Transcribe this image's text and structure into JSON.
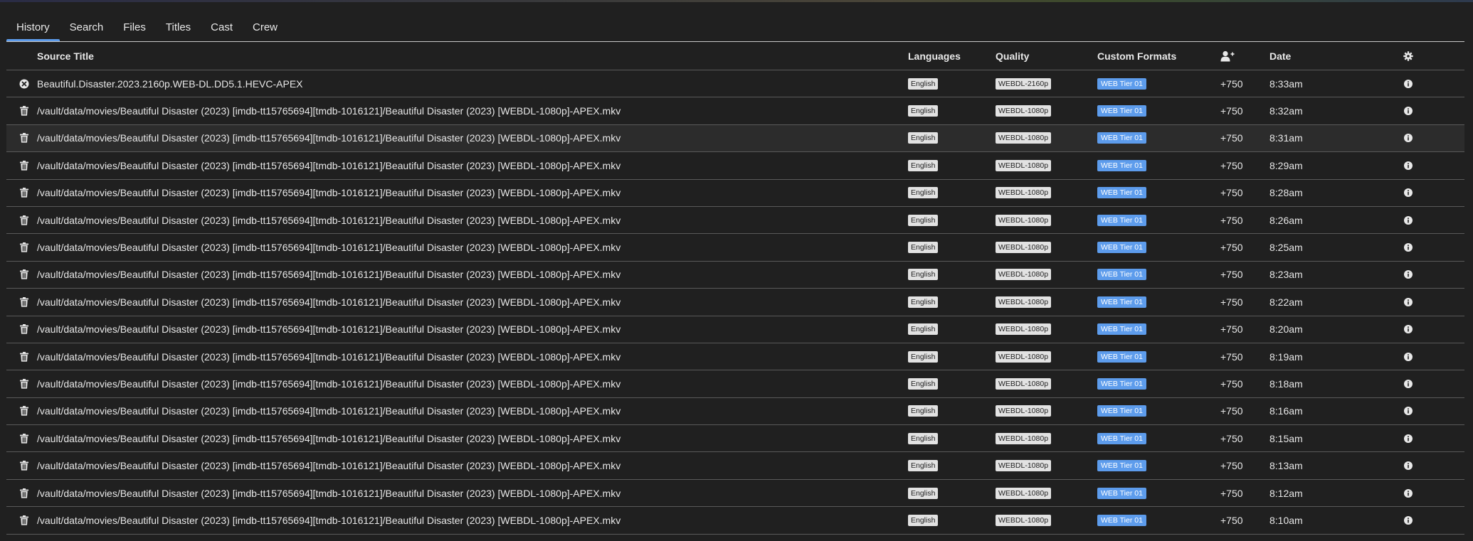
{
  "tabs": [
    {
      "label": "History",
      "active": true
    },
    {
      "label": "Search",
      "active": false
    },
    {
      "label": "Files",
      "active": false
    },
    {
      "label": "Titles",
      "active": false
    },
    {
      "label": "Cast",
      "active": false
    },
    {
      "label": "Crew",
      "active": false
    }
  ],
  "table": {
    "headers": {
      "source_title": "Source Title",
      "languages": "Languages",
      "quality": "Quality",
      "custom_formats": "Custom Formats",
      "score_icon": "user-plus-icon",
      "date": "Date",
      "settings_icon": "gear-icon"
    },
    "rows": [
      {
        "icon": "circle-x-icon",
        "title": "Beautiful.Disaster.2023.2160p.WEB-DL.DD5.1.HEVC-APEX",
        "language": "English",
        "quality": "WEBDL-2160p",
        "custom_format": "WEB Tier 01",
        "score": "+750",
        "date": "8:33am"
      },
      {
        "icon": "trash-icon",
        "title": "/vault/data/movies/Beautiful Disaster (2023) [imdb-tt15765694][tmdb-1016121]/Beautiful Disaster (2023) [WEBDL-1080p]-APEX.mkv",
        "language": "English",
        "quality": "WEBDL-1080p",
        "custom_format": "WEB Tier 01",
        "score": "+750",
        "date": "8:32am"
      },
      {
        "icon": "trash-icon",
        "title": "/vault/data/movies/Beautiful Disaster (2023) [imdb-tt15765694][tmdb-1016121]/Beautiful Disaster (2023) [WEBDL-1080p]-APEX.mkv",
        "language": "English",
        "quality": "WEBDL-1080p",
        "custom_format": "WEB Tier 01",
        "score": "+750",
        "date": "8:31am",
        "highlighted": true
      },
      {
        "icon": "trash-icon",
        "title": "/vault/data/movies/Beautiful Disaster (2023) [imdb-tt15765694][tmdb-1016121]/Beautiful Disaster (2023) [WEBDL-1080p]-APEX.mkv",
        "language": "English",
        "quality": "WEBDL-1080p",
        "custom_format": "WEB Tier 01",
        "score": "+750",
        "date": "8:29am"
      },
      {
        "icon": "trash-icon",
        "title": "/vault/data/movies/Beautiful Disaster (2023) [imdb-tt15765694][tmdb-1016121]/Beautiful Disaster (2023) [WEBDL-1080p]-APEX.mkv",
        "language": "English",
        "quality": "WEBDL-1080p",
        "custom_format": "WEB Tier 01",
        "score": "+750",
        "date": "8:28am"
      },
      {
        "icon": "trash-icon",
        "title": "/vault/data/movies/Beautiful Disaster (2023) [imdb-tt15765694][tmdb-1016121]/Beautiful Disaster (2023) [WEBDL-1080p]-APEX.mkv",
        "language": "English",
        "quality": "WEBDL-1080p",
        "custom_format": "WEB Tier 01",
        "score": "+750",
        "date": "8:26am"
      },
      {
        "icon": "trash-icon",
        "title": "/vault/data/movies/Beautiful Disaster (2023) [imdb-tt15765694][tmdb-1016121]/Beautiful Disaster (2023) [WEBDL-1080p]-APEX.mkv",
        "language": "English",
        "quality": "WEBDL-1080p",
        "custom_format": "WEB Tier 01",
        "score": "+750",
        "date": "8:25am"
      },
      {
        "icon": "trash-icon",
        "title": "/vault/data/movies/Beautiful Disaster (2023) [imdb-tt15765694][tmdb-1016121]/Beautiful Disaster (2023) [WEBDL-1080p]-APEX.mkv",
        "language": "English",
        "quality": "WEBDL-1080p",
        "custom_format": "WEB Tier 01",
        "score": "+750",
        "date": "8:23am"
      },
      {
        "icon": "trash-icon",
        "title": "/vault/data/movies/Beautiful Disaster (2023) [imdb-tt15765694][tmdb-1016121]/Beautiful Disaster (2023) [WEBDL-1080p]-APEX.mkv",
        "language": "English",
        "quality": "WEBDL-1080p",
        "custom_format": "WEB Tier 01",
        "score": "+750",
        "date": "8:22am"
      },
      {
        "icon": "trash-icon",
        "title": "/vault/data/movies/Beautiful Disaster (2023) [imdb-tt15765694][tmdb-1016121]/Beautiful Disaster (2023) [WEBDL-1080p]-APEX.mkv",
        "language": "English",
        "quality": "WEBDL-1080p",
        "custom_format": "WEB Tier 01",
        "score": "+750",
        "date": "8:20am"
      },
      {
        "icon": "trash-icon",
        "title": "/vault/data/movies/Beautiful Disaster (2023) [imdb-tt15765694][tmdb-1016121]/Beautiful Disaster (2023) [WEBDL-1080p]-APEX.mkv",
        "language": "English",
        "quality": "WEBDL-1080p",
        "custom_format": "WEB Tier 01",
        "score": "+750",
        "date": "8:19am"
      },
      {
        "icon": "trash-icon",
        "title": "/vault/data/movies/Beautiful Disaster (2023) [imdb-tt15765694][tmdb-1016121]/Beautiful Disaster (2023) [WEBDL-1080p]-APEX.mkv",
        "language": "English",
        "quality": "WEBDL-1080p",
        "custom_format": "WEB Tier 01",
        "score": "+750",
        "date": "8:18am"
      },
      {
        "icon": "trash-icon",
        "title": "/vault/data/movies/Beautiful Disaster (2023) [imdb-tt15765694][tmdb-1016121]/Beautiful Disaster (2023) [WEBDL-1080p]-APEX.mkv",
        "language": "English",
        "quality": "WEBDL-1080p",
        "custom_format": "WEB Tier 01",
        "score": "+750",
        "date": "8:16am"
      },
      {
        "icon": "trash-icon",
        "title": "/vault/data/movies/Beautiful Disaster (2023) [imdb-tt15765694][tmdb-1016121]/Beautiful Disaster (2023) [WEBDL-1080p]-APEX.mkv",
        "language": "English",
        "quality": "WEBDL-1080p",
        "custom_format": "WEB Tier 01",
        "score": "+750",
        "date": "8:15am"
      },
      {
        "icon": "trash-icon",
        "title": "/vault/data/movies/Beautiful Disaster (2023) [imdb-tt15765694][tmdb-1016121]/Beautiful Disaster (2023) [WEBDL-1080p]-APEX.mkv",
        "language": "English",
        "quality": "WEBDL-1080p",
        "custom_format": "WEB Tier 01",
        "score": "+750",
        "date": "8:13am"
      },
      {
        "icon": "trash-icon",
        "title": "/vault/data/movies/Beautiful Disaster (2023) [imdb-tt15765694][tmdb-1016121]/Beautiful Disaster (2023) [WEBDL-1080p]-APEX.mkv",
        "language": "English",
        "quality": "WEBDL-1080p",
        "custom_format": "WEB Tier 01",
        "score": "+750",
        "date": "8:12am"
      },
      {
        "icon": "trash-icon",
        "title": "/vault/data/movies/Beautiful Disaster (2023) [imdb-tt15765694][tmdb-1016121]/Beautiful Disaster (2023) [WEBDL-1080p]-APEX.mkv",
        "language": "English",
        "quality": "WEBDL-1080p",
        "custom_format": "WEB Tier 01",
        "score": "+750",
        "date": "8:10am"
      }
    ]
  },
  "colors": {
    "background": "#202020",
    "accent": "#5d9cec",
    "badge_light": "#e2e2e2"
  }
}
